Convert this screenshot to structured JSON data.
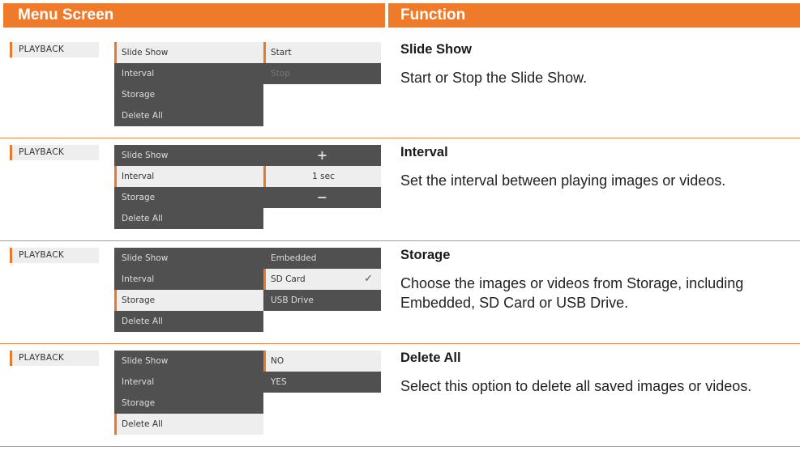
{
  "header": {
    "left": "Menu Screen",
    "right": "Function"
  },
  "rows": [
    {
      "tab": "PLAYBACK",
      "menu": [
        "Slide Show",
        "Interval",
        "Storage",
        "Delete All"
      ],
      "selected_menu": "Slide Show",
      "sub": [
        {
          "label": "Start",
          "selected": true
        },
        {
          "label": "Stop",
          "dim": true
        }
      ],
      "title": "Slide Show",
      "desc": "Start or Stop the Slide Show."
    },
    {
      "tab": "PLAYBACK",
      "menu": [
        "Slide Show",
        "Interval",
        "Storage",
        "Delete All"
      ],
      "selected_menu": "Interval",
      "sub": [
        {
          "label": "+",
          "icon": "plus-icon"
        },
        {
          "label": "1 sec",
          "selected": true
        },
        {
          "label": "−",
          "icon": "minus-icon"
        }
      ],
      "title": "Interval",
      "desc": "Set the interval between playing images or videos."
    },
    {
      "tab": "PLAYBACK",
      "menu": [
        "Slide Show",
        "Interval",
        "Storage",
        "Delete All"
      ],
      "selected_menu": "Storage",
      "sub": [
        {
          "label": "Embedded"
        },
        {
          "label": "SD Card",
          "selected": true,
          "check": "✓"
        },
        {
          "label": "USB Drive"
        }
      ],
      "title": "Storage",
      "desc": "Choose the images or videos from Storage, including Embedded, SD Card or USB Drive."
    },
    {
      "tab": "PLAYBACK",
      "menu": [
        "Slide Show",
        "Interval",
        "Storage",
        "Delete All"
      ],
      "selected_menu": "Delete All",
      "sub": [
        {
          "label": "NO",
          "selected": true
        },
        {
          "label": "YES"
        }
      ],
      "title": "Delete All",
      "desc": "Select this option to delete all saved images or videos."
    }
  ]
}
